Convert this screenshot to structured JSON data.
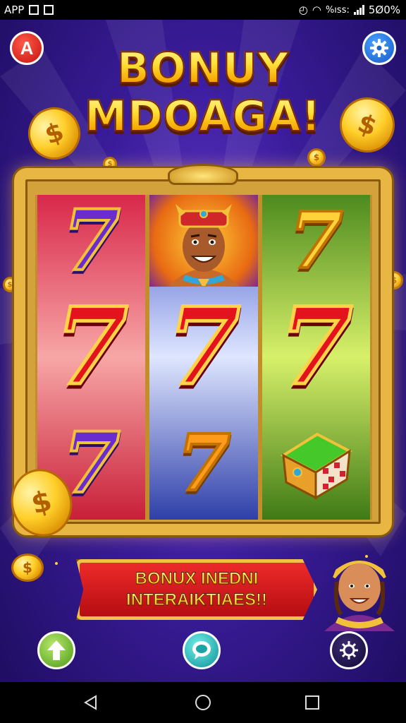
{
  "status_bar": {
    "app_label": "APP",
    "right_text": "%ıss:",
    "battery_text": "5Ø0%"
  },
  "header": {
    "profile_button_letter": "A",
    "title_line1": "BONUY",
    "title_line2": "MDOAGA!"
  },
  "reels": [
    {
      "symbols": [
        "purple-seven",
        "red-seven",
        "purple-seven"
      ]
    },
    {
      "symbols": [
        "tribal-chief-portrait",
        "red-seven",
        "gold-seven"
      ]
    },
    {
      "symbols": [
        "gold-seven",
        "red-seven",
        "treasure-house"
      ]
    }
  ],
  "symbol_glyph": "7",
  "coin_glyph": "$",
  "banner": {
    "line1": "BONUX INEDNI",
    "line2": "INTERAIKTIAES!!"
  },
  "bottom_buttons": [
    {
      "icon": "home-arrow-icon"
    },
    {
      "icon": "chat-bubble-icon"
    },
    {
      "icon": "gear-icon"
    }
  ],
  "nav_bar": {
    "buttons": [
      "back-icon",
      "home-circle-icon",
      "recents-square-icon"
    ]
  },
  "colors": {
    "background": "#3a1c9a",
    "frame_gold": "#e7b643",
    "banner_red": "#d01a1f"
  }
}
